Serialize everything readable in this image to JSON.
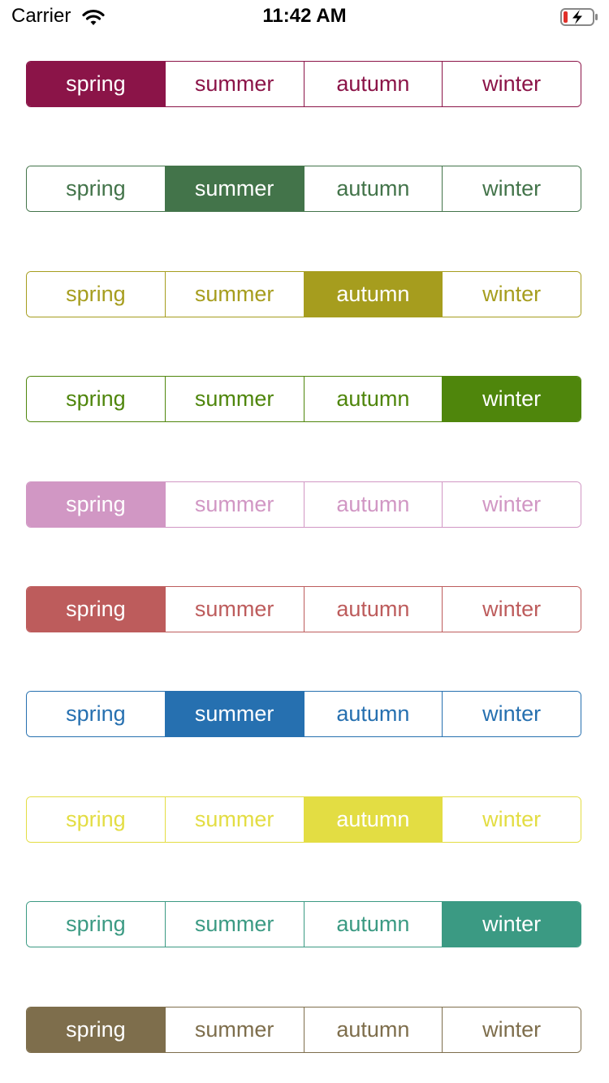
{
  "status_bar": {
    "carrier": "Carrier",
    "time": "11:42 AM",
    "wifi_icon": "wifi-icon",
    "battery_icon": "battery-charging-icon"
  },
  "segments": [
    "spring",
    "summer",
    "autumn",
    "winter"
  ],
  "controls": [
    {
      "color": "#8b1448",
      "selected": 0
    },
    {
      "color": "#43744a",
      "selected": 1
    },
    {
      "color": "#a69d1e",
      "selected": 2
    },
    {
      "color": "#4f860c",
      "selected": 3
    },
    {
      "color": "#d197c4",
      "selected": 0
    },
    {
      "color": "#bd5c5c",
      "selected": 0
    },
    {
      "color": "#2670b0",
      "selected": 1
    },
    {
      "color": "#e3dd43",
      "selected": 2
    },
    {
      "color": "#3b9a83",
      "selected": 3
    },
    {
      "color": "#7e6e4c",
      "selected": 0
    }
  ]
}
